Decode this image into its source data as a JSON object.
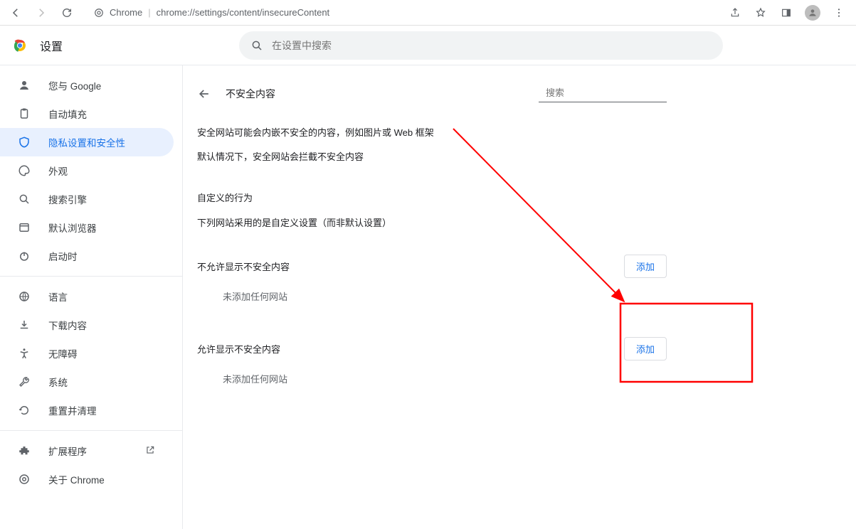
{
  "browser": {
    "url_label": "Chrome",
    "url_path": "chrome://settings/content/insecureContent"
  },
  "header": {
    "title": "设置",
    "search_placeholder": "在设置中搜索"
  },
  "sidebar": {
    "items": {
      "profile": "您与 Google",
      "autofill": "自动填充",
      "privacy": "隐私设置和安全性",
      "appearance": "外观",
      "search_engine": "搜索引擎",
      "default_browser": "默认浏览器",
      "startup": "启动时",
      "languages": "语言",
      "downloads": "下载内容",
      "accessibility": "无障碍",
      "system": "系统",
      "reset": "重置并清理",
      "extensions": "扩展程序",
      "about": "关于 Chrome"
    }
  },
  "content": {
    "page_title": "不安全内容",
    "page_search_placeholder": "搜索",
    "desc1": "安全网站可能会内嵌不安全的内容，例如图片或 Web 框架",
    "desc2": "默认情况下，安全网站会拦截不安全内容",
    "custom_title": "自定义的行为",
    "custom_sub": "下列网站采用的是自定义设置（而非默认设置）",
    "block_label": "不允许显示不安全内容",
    "allow_label": "允许显示不安全内容",
    "add_button": "添加",
    "no_sites": "未添加任何网站"
  }
}
